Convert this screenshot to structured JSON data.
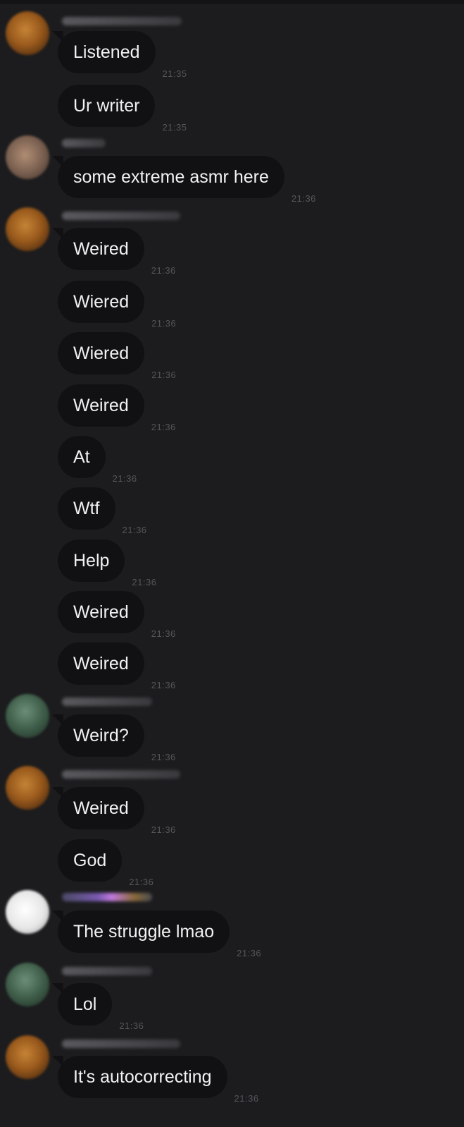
{
  "chat": {
    "messages": [
      {
        "text": "Listened",
        "time": "21:35"
      },
      {
        "text": "Ur writer",
        "time": "21:35"
      },
      {
        "text": "some extreme asmr here",
        "time": "21:36"
      },
      {
        "text": "Weired",
        "time": "21:36"
      },
      {
        "text": "Wiered",
        "time": "21:36"
      },
      {
        "text": "Wiered",
        "time": "21:36"
      },
      {
        "text": "Weired",
        "time": "21:36"
      },
      {
        "text": "At",
        "time": "21:36"
      },
      {
        "text": "Wtf",
        "time": "21:36"
      },
      {
        "text": "Help",
        "time": "21:36"
      },
      {
        "text": "Weired",
        "time": "21:36"
      },
      {
        "text": "Weired",
        "time": "21:36"
      },
      {
        "text": "Weird?",
        "time": "21:36"
      },
      {
        "text": "Weired",
        "time": "21:36"
      },
      {
        "text": "God",
        "time": "21:36"
      },
      {
        "text": "The struggle lmao",
        "time": "21:36"
      },
      {
        "text": "Lol",
        "time": "21:36"
      },
      {
        "text": "It's autocorrecting",
        "time": "21:36"
      }
    ]
  },
  "colors": {
    "background": "#1c1c1e",
    "bubble": "#111113",
    "text": "#f2f2f2",
    "timestamp": "#55555a"
  }
}
